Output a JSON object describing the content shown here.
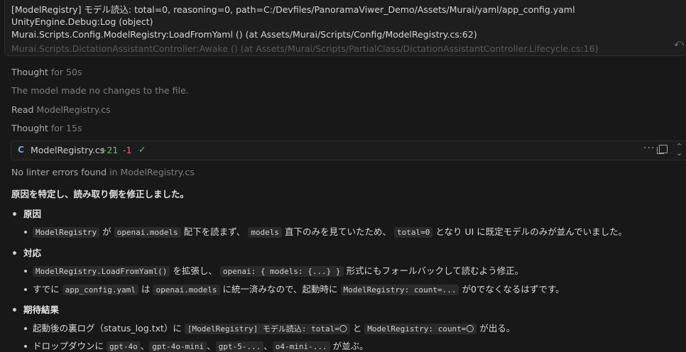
{
  "log": {
    "line1": "[ModelRegistry] モデル読込: total=0, reasoning=0, path=C:/Devfiles/PanoramaViwer_Demo/Assets/Murai/yaml/app_config.yaml",
    "line2": "UnityEngine.Debug:Log (object)",
    "line3": "Murai.Scripts.Config.ModelRegistry:LoadFromYaml () (at Assets/Murai/Scripts/Config/ModelRegistry.cs:62)",
    "line4": "Murai.Scripts.DictationAssistantController:Awake () (at Assets/Murai/Scripts/PartialClass/DictationAssistantController.Lifecycle.cs:16)",
    "undo_icon": "undo-icon"
  },
  "steps": {
    "thought1_label": "Thought",
    "thought1_duration": "for 50s",
    "no_changes": "The model made no changes to the file.",
    "read_label": "Read",
    "read_file": "ModelRegistry.cs",
    "thought2_label": "Thought",
    "thought2_duration": "for 15s"
  },
  "file_card": {
    "icon": "C#",
    "filename": "ModelRegistry.cs",
    "added": "+21",
    "removed": "-1",
    "check": "✓",
    "more": "···",
    "expand": "⌃⌄"
  },
  "linter": {
    "text": "No linter errors found",
    "in_file": "in ModelRegistry.cs"
  },
  "summary": "原因を特定し、読み取り側を修正しました。",
  "cause": {
    "heading": "原因",
    "item1": {
      "c1": "ModelRegistry",
      "t1": "が",
      "c2": "openai.models",
      "t2": "配下を読まず、",
      "c3": "models",
      "t3": "直下のみを見ていたため、",
      "c4": "total=0",
      "t4": "となり UI に既定モデルのみが並んでいました。"
    }
  },
  "fix": {
    "heading": "対応",
    "item1": {
      "c1": "ModelRegistry.LoadFromYaml()",
      "t1": "を拡張し、",
      "c2": "openai: { models: {...} }",
      "t2": "形式にもフォールバックして読むよう修正。"
    },
    "item2": {
      "t0": "すでに",
      "c1": "app_config.yaml",
      "t1": "は",
      "c2": "openai.models",
      "t2": "に統一済みなので、起動時に",
      "c3": "ModelRegistry: count=...",
      "t3": "が0でなくなるはずです。"
    }
  },
  "expected": {
    "heading": "期待結果",
    "item1": {
      "t0": "起動後の裏ログ（status_log.txt）に",
      "c1": "[ModelRegistry] モデル読込: total=〇",
      "t1": "と",
      "c2": "ModelRegistry: count=〇",
      "t2": "が出る。"
    },
    "item2": {
      "t0": "ドロップダウンに",
      "c1": "gpt-4o",
      "s1": "、",
      "c2": "gpt-4o-mini",
      "s2": "、",
      "c3": "gpt-5-...",
      "s3": "、",
      "c4": "o4-mini-...",
      "t1": "が並ぶ。"
    }
  }
}
